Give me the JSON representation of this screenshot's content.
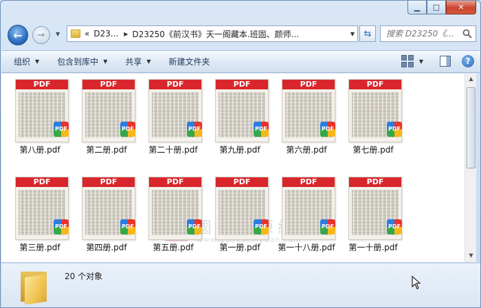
{
  "window": {
    "controls": [
      "minimize",
      "maximize",
      "close"
    ]
  },
  "nav": {
    "back_label": "back",
    "forward_label": "forward"
  },
  "address": {
    "prefix": "«",
    "crumb1": "D23...",
    "crumb2": "D23250《前汉书》天一阁藏本.班固、颜师...",
    "refresh_icon": "refresh-icon"
  },
  "search": {
    "placeholder": "搜索 D23250《..."
  },
  "toolbar": {
    "organize": "组织",
    "include_in_library": "包含到库中",
    "share": "共享",
    "new_folder": "新建文件夹"
  },
  "files": [
    {
      "name": "第八册.pdf",
      "badge": "PDF",
      "band": "PDF"
    },
    {
      "name": "第二册.pdf",
      "badge": "PDF",
      "band": "PDF"
    },
    {
      "name": "第二十册.pdf",
      "badge": "PDF",
      "band": "PDF"
    },
    {
      "name": "第九册.pdf",
      "badge": "PDF",
      "band": "PDF"
    },
    {
      "name": "第六册.pdf",
      "badge": "PDF",
      "band": "PDF"
    },
    {
      "name": "第七册.pdf",
      "badge": "PDF",
      "band": "PDF"
    },
    {
      "name": "第三册.pdf",
      "badge": "PDF",
      "band": "PDF"
    },
    {
      "name": "第四册.pdf",
      "badge": "PDF",
      "band": "PDF"
    },
    {
      "name": "第五册.pdf",
      "badge": "PDF",
      "band": "PDF"
    },
    {
      "name": "第一册.pdf",
      "badge": "PDF",
      "band": "PDF"
    },
    {
      "name": "第一十八册.pdf",
      "badge": "PDF",
      "band": "PDF"
    },
    {
      "name": "第一十册.pdf",
      "badge": "PDF",
      "band": "PDF"
    }
  ],
  "watermark": {
    "seal": "臨",
    "title": "國學資源網",
    "url": "www.guoxueziyuan.com"
  },
  "details": {
    "count": "20 个对象"
  },
  "colors": {
    "pdf_red": "#d8262c",
    "accent_blue": "#2a6fc0"
  }
}
